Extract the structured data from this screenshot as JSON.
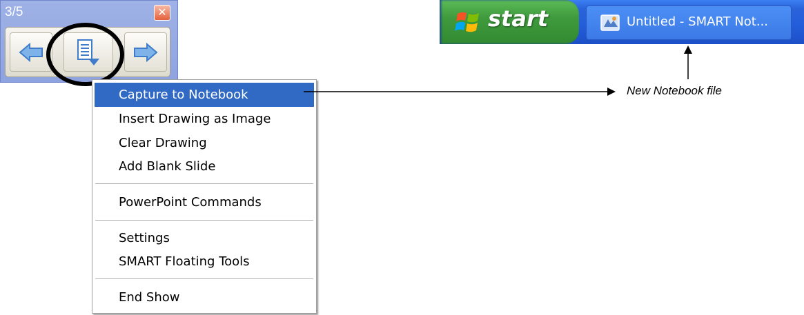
{
  "toolbar": {
    "slide_counter": "3/5",
    "close_glyph": "✕",
    "buttons": [
      "left-arrow-icon",
      "menu-page-icon",
      "right-arrow-icon"
    ]
  },
  "menu": {
    "items": [
      {
        "label": "Capture to Notebook",
        "selected": true
      },
      {
        "label": "Insert Drawing as Image"
      },
      {
        "label": "Clear Drawing"
      },
      {
        "label": "Add Blank Slide"
      },
      {
        "label": "PowerPoint Commands"
      },
      {
        "label": "Settings"
      },
      {
        "label": "SMART Floating Tools"
      },
      {
        "label": "End Show"
      }
    ]
  },
  "taskbar": {
    "start_label": "start",
    "task_label": "Untitled - SMART Not..."
  },
  "callout": {
    "text": "New Notebook file"
  },
  "colors": {
    "menu_highlight": "#316ac5",
    "taskbar_blue": "#245edb",
    "start_green": "#3f9a3d"
  }
}
